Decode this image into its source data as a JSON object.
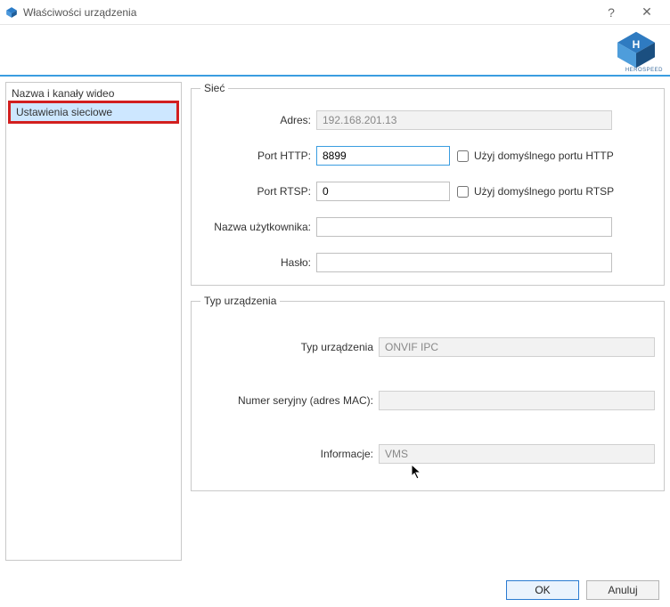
{
  "window": {
    "title": "Właściwości urządzenia",
    "help_glyph": "?",
    "close_glyph": "✕"
  },
  "brand": "HEROSPEED",
  "sidebar": {
    "items": [
      {
        "label": "Nazwa i kanały wideo"
      },
      {
        "label": "Ustawienia sieciowe"
      }
    ]
  },
  "groups": {
    "net": {
      "legend": "Sieć",
      "address_label": "Adres:",
      "address_value": "192.168.201.13",
      "http_label": "Port HTTP:",
      "http_value": "8899",
      "http_chk": "Użyj domyślnego portu HTTP",
      "rtsp_label": "Port RTSP:",
      "rtsp_value": "0",
      "rtsp_chk": "Użyj domyślnego portu RTSP",
      "user_label": "Nazwa użytkownika:",
      "user_value": "",
      "pass_label": "Hasło:",
      "pass_value": ""
    },
    "dev": {
      "legend": "Typ urządzenia",
      "type_label": "Typ urządzenia",
      "type_value": "ONVIF IPC",
      "serial_label": "Numer seryjny (adres MAC):",
      "serial_value": "",
      "info_label": "Informacje:",
      "info_value": "VMS"
    }
  },
  "buttons": {
    "ok": "OK",
    "cancel": "Anuluj"
  }
}
